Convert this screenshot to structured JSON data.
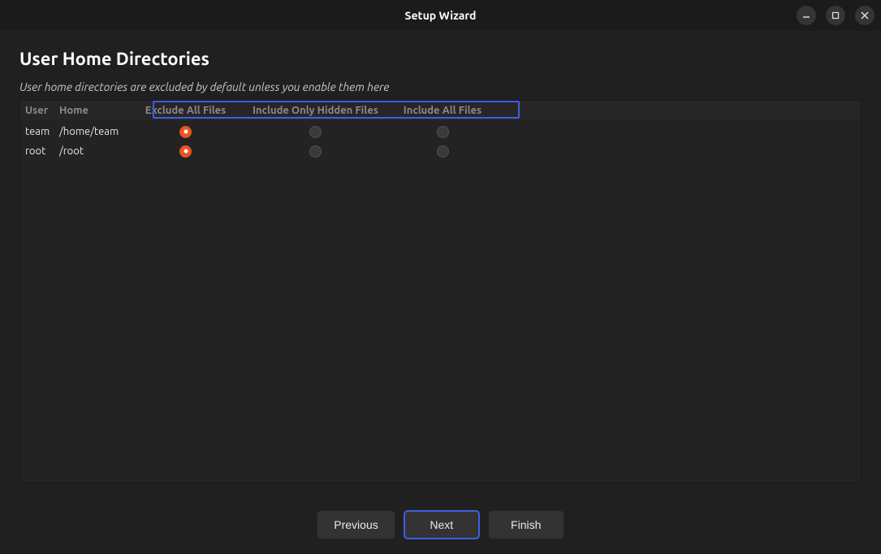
{
  "window": {
    "title": "Setup Wizard"
  },
  "page": {
    "title": "User Home Directories",
    "subtitle": "User home directories are excluded by default unless you enable them here"
  },
  "columns": {
    "user": "User",
    "home": "Home",
    "exclude": "Exclude All Files",
    "hidden": "Include Only Hidden Files",
    "include": "Include All Files"
  },
  "rows": [
    {
      "user": "team",
      "home": "/home/team",
      "selection": "exclude"
    },
    {
      "user": "root",
      "home": "/root",
      "selection": "exclude"
    }
  ],
  "buttons": {
    "previous": "Previous",
    "next": "Next",
    "finish": "Finish"
  },
  "focus": {
    "button": "next",
    "header_highlight": true
  },
  "colors": {
    "accent": "#e95420",
    "focus_ring": "#3d5fe0"
  }
}
